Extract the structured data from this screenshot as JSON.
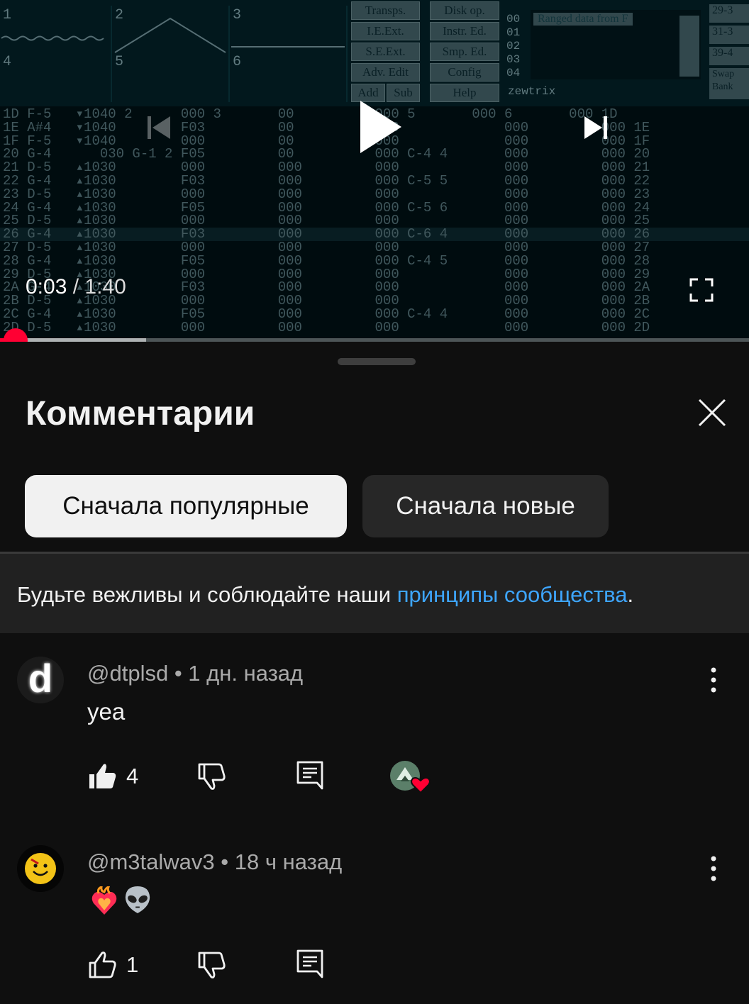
{
  "player": {
    "current_time": "0:03",
    "separator": "/",
    "duration": "1:40",
    "progress_fraction": 0.03,
    "buffer_fraction": 0.195,
    "tracker": {
      "scope_labels": [
        "1",
        "2",
        "3",
        "4",
        "5",
        "6"
      ],
      "buttons": [
        "Transps.",
        "Disk op.",
        "I.E.Ext.",
        "Instr. Ed.",
        "S.E.Ext.",
        "Smp. Ed.",
        "Adv. Edit",
        "Config",
        "Add",
        "Sub",
        "Help"
      ],
      "sample_numbers": [
        "00",
        "01",
        "02",
        "03",
        "04"
      ],
      "instrument_name": "Ranged data from F",
      "author": "zewtrix",
      "bank_labels": [
        "29-3",
        "31-3",
        "39-4",
        "Swap Bank"
      ],
      "pattern_text": "1D F-5   ▾1040 2      000 3       00          000 5       000 6       000 1D\n1E A#4   ▾1040        F03         00          000             000         000 1E\n1F F-5   ▾1040        000         00          000             000         000 1F\n20 G-4      030 G-1 2 F05         00          000 C-4 4       000         000 20\n21 D-5   ▴1030        000         000         000             000         000 21\n22 G-4   ▴1030        F03         000         000 C-5 5       000         000 22\n23 D-5   ▴1030        000         000         000             000         000 23\n24 G-4   ▴1030        F05         000         000 C-5 6       000         000 24\n25 D-5   ▴1030        000         000         000             000         000 25\n26 G-4   ▴1030        F03         000         000 C-6 4       000         000 26\n27 D-5   ▴1030        000         000         000             000         000 27\n28 G-4   ▴1030        F05         000         000 C-4 5       000         000 28\n29 D-5   ▴1030        000         000         000             000         000 29\n2A G-4   ▴1030        F03         000         000             000         000 2A\n2B D-5   ▴1030        000         000         000             000         000 2B\n2C G-4   ▴1030        F05         000         000 C-4 4       000         000 2C\n2D D-5   ▴1030        000         000         000             000         000 2D"
    }
  },
  "comments_panel": {
    "title": "Комментарии",
    "chips": [
      "Сначала популярные",
      "Сначала новые"
    ],
    "selected_chip": "Сначала популярные",
    "guidelines_text": "Будьте вежливы и соблюдайте наши ",
    "guidelines_link": "принципы сообщества",
    "guidelines_end": ".",
    "colors": {
      "link": "#3ea6ff",
      "accent": "#ff0033",
      "chip_active_bg": "#f1f1f1"
    }
  },
  "comments": [
    {
      "author": "@dtplsd",
      "dot": " • ",
      "time": "1 дн. назад",
      "text": "yea",
      "likes": "4",
      "liked": true,
      "creator_heart": true,
      "avatar_letter": "d"
    },
    {
      "author": "@m3talwav3",
      "dot": " • ",
      "time": "18 ч назад",
      "text": "❤️‍🔥👽",
      "likes": "1",
      "liked": false,
      "creator_heart": false,
      "avatar_icon": "smiley-face-icon"
    }
  ]
}
